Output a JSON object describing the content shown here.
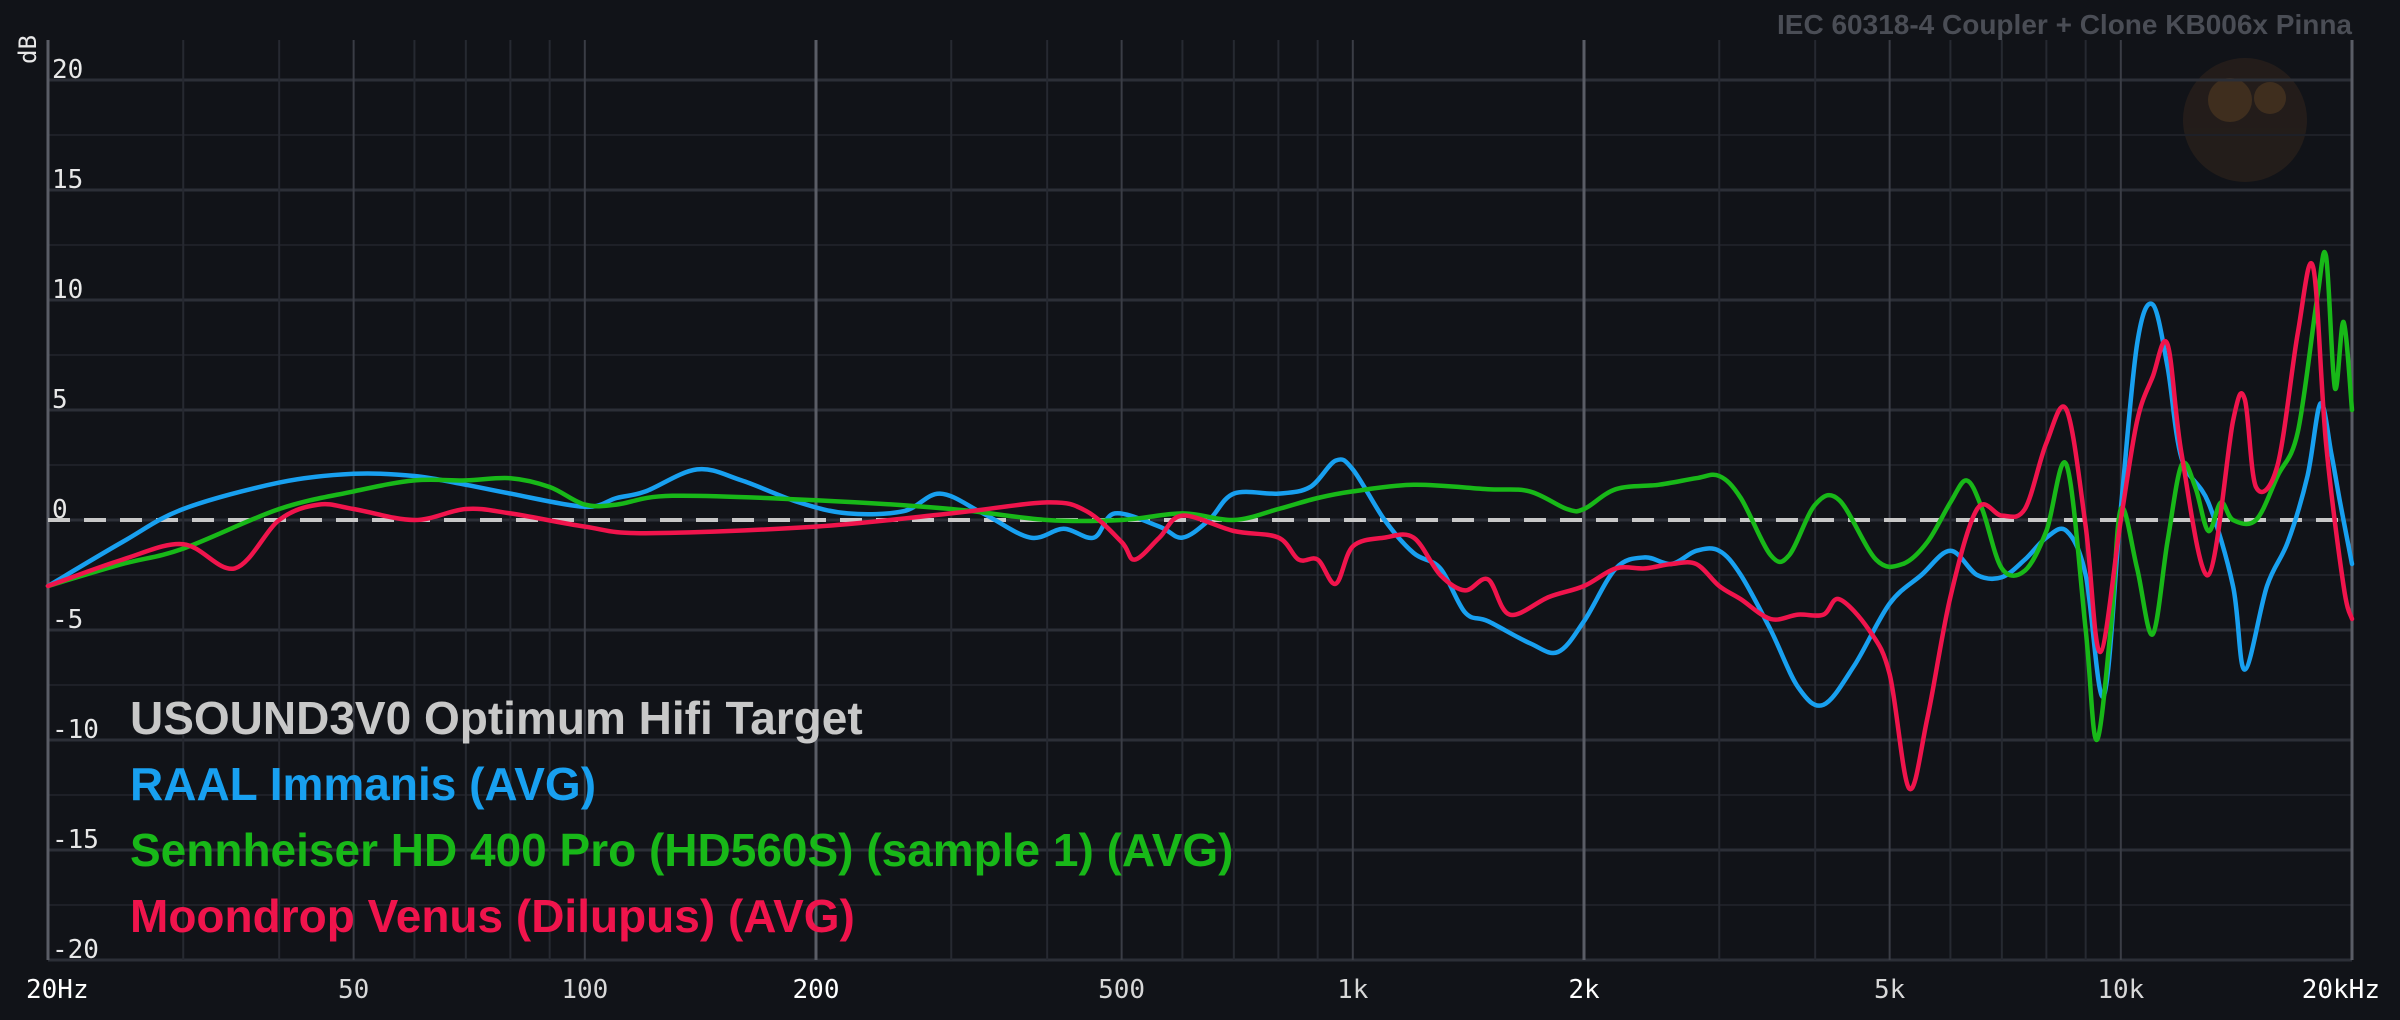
{
  "chart_data": {
    "type": "line",
    "title": "IEC 60318-4 Coupler + Clone KB006x Pinna",
    "ylabel": "dB",
    "xscale": "log",
    "xlim": [
      20,
      20000
    ],
    "ylim": [
      -20,
      21
    ],
    "y_ticks": [
      {
        "value": 20,
        "label": "20"
      },
      {
        "value": 15,
        "label": "15"
      },
      {
        "value": 10,
        "label": "10"
      },
      {
        "value": 5,
        "label": "5"
      },
      {
        "value": 0,
        "label": "0"
      },
      {
        "value": -5,
        "label": "-5"
      },
      {
        "value": -10,
        "label": "-10"
      },
      {
        "value": -15,
        "label": "-15"
      },
      {
        "value": -20,
        "label": "-20"
      }
    ],
    "x_ticks": [
      {
        "value": 20,
        "label": "20Hz",
        "major": true
      },
      {
        "value": 50,
        "label": "50",
        "major": false
      },
      {
        "value": 100,
        "label": "100",
        "major": false
      },
      {
        "value": 200,
        "label": "200",
        "major": true
      },
      {
        "value": 500,
        "label": "500",
        "major": false
      },
      {
        "value": 1000,
        "label": "1k",
        "major": false
      },
      {
        "value": 2000,
        "label": "2k",
        "major": true
      },
      {
        "value": 5000,
        "label": "5k",
        "major": false
      },
      {
        "value": 10000,
        "label": "10k",
        "major": false
      },
      {
        "value": 20000,
        "label": "20kHz",
        "major": true
      }
    ],
    "grid": true,
    "legend_position": "bottom-left",
    "series": [
      {
        "name": "USOUND3V0 Optimum Hifi Target",
        "color": "#c8c8c8",
        "style": "dashed",
        "points": [
          [
            20,
            0
          ],
          [
            20000,
            0
          ]
        ]
      },
      {
        "name": "RAAL Immanis (AVG)",
        "color": "#18a0f0",
        "points": [
          [
            20,
            -3
          ],
          [
            25,
            -1
          ],
          [
            30,
            0.5
          ],
          [
            40,
            1.7
          ],
          [
            50,
            2.1
          ],
          [
            60,
            2.0
          ],
          [
            70,
            1.6
          ],
          [
            80,
            1.2
          ],
          [
            100,
            0.6
          ],
          [
            110,
            1.0
          ],
          [
            120,
            1.3
          ],
          [
            140,
            2.3
          ],
          [
            160,
            1.8
          ],
          [
            190,
            0.8
          ],
          [
            220,
            0.3
          ],
          [
            260,
            0.4
          ],
          [
            290,
            1.2
          ],
          [
            330,
            0.3
          ],
          [
            380,
            -0.8
          ],
          [
            420,
            -0.4
          ],
          [
            460,
            -0.8
          ],
          [
            490,
            0.3
          ],
          [
            560,
            -0.3
          ],
          [
            600,
            -0.8
          ],
          [
            650,
            0
          ],
          [
            700,
            1.2
          ],
          [
            800,
            1.2
          ],
          [
            880,
            1.5
          ],
          [
            950,
            2.7
          ],
          [
            1000,
            2.3
          ],
          [
            1100,
            0
          ],
          [
            1200,
            -1.5
          ],
          [
            1300,
            -2.2
          ],
          [
            1400,
            -4.2
          ],
          [
            1500,
            -4.6
          ],
          [
            1700,
            -5.6
          ],
          [
            1850,
            -6.0
          ],
          [
            2000,
            -4.6
          ],
          [
            2200,
            -2.2
          ],
          [
            2400,
            -1.7
          ],
          [
            2600,
            -2.0
          ],
          [
            2800,
            -1.4
          ],
          [
            3000,
            -1.4
          ],
          [
            3200,
            -2.5
          ],
          [
            3500,
            -5.0
          ],
          [
            3800,
            -7.6
          ],
          [
            4100,
            -8.4
          ],
          [
            4500,
            -6.6
          ],
          [
            5000,
            -3.8
          ],
          [
            5500,
            -2.5
          ],
          [
            6000,
            -1.4
          ],
          [
            6500,
            -2.5
          ],
          [
            7000,
            -2.6
          ],
          [
            7500,
            -1.8
          ],
          [
            8000,
            -0.8
          ],
          [
            8500,
            -0.5
          ],
          [
            9000,
            -2.5
          ],
          [
            9500,
            -8.0
          ],
          [
            10000,
            0.5
          ],
          [
            10500,
            8.0
          ],
          [
            11000,
            9.8
          ],
          [
            11500,
            7.0
          ],
          [
            12000,
            2.8
          ],
          [
            13000,
            0.8
          ],
          [
            14000,
            -3.0
          ],
          [
            14500,
            -6.8
          ],
          [
            15500,
            -3.0
          ],
          [
            16500,
            -1.0
          ],
          [
            17500,
            2.0
          ],
          [
            18200,
            5.3
          ],
          [
            18800,
            3.0
          ],
          [
            19300,
            0.8
          ],
          [
            20000,
            -2.0
          ]
        ]
      },
      {
        "name": "Sennheiser HD 400 Pro (HD560S) (sample 1) (AVG)",
        "color": "#18b818",
        "points": [
          [
            20,
            -3
          ],
          [
            25,
            -2
          ],
          [
            30,
            -1.3
          ],
          [
            40,
            0.5
          ],
          [
            50,
            1.3
          ],
          [
            60,
            1.8
          ],
          [
            70,
            1.8
          ],
          [
            80,
            1.9
          ],
          [
            90,
            1.5
          ],
          [
            100,
            0.7
          ],
          [
            110,
            0.7
          ],
          [
            130,
            1.1
          ],
          [
            200,
            0.9
          ],
          [
            300,
            0.5
          ],
          [
            400,
            0
          ],
          [
            500,
            0
          ],
          [
            600,
            0.3
          ],
          [
            700,
            0
          ],
          [
            800,
            0.5
          ],
          [
            900,
            1.0
          ],
          [
            1000,
            1.3
          ],
          [
            1200,
            1.6
          ],
          [
            1500,
            1.4
          ],
          [
            1700,
            1.3
          ],
          [
            1900,
            0.5
          ],
          [
            2000,
            0.5
          ],
          [
            2200,
            1.4
          ],
          [
            2500,
            1.6
          ],
          [
            2800,
            1.9
          ],
          [
            3000,
            2.0
          ],
          [
            3200,
            1.0
          ],
          [
            3500,
            -1.6
          ],
          [
            3700,
            -1.6
          ],
          [
            4000,
            0.7
          ],
          [
            4300,
            0.9
          ],
          [
            4800,
            -1.8
          ],
          [
            5200,
            -2.0
          ],
          [
            5600,
            -1.0
          ],
          [
            6000,
            0.8
          ],
          [
            6300,
            1.8
          ],
          [
            6600,
            0.5
          ],
          [
            7000,
            -2.2
          ],
          [
            7500,
            -2.3
          ],
          [
            8000,
            -0.5
          ],
          [
            8500,
            2.5
          ],
          [
            9000,
            -5.0
          ],
          [
            9300,
            -10.0
          ],
          [
            9700,
            -5.0
          ],
          [
            10000,
            0.5
          ],
          [
            10500,
            -2.2
          ],
          [
            11000,
            -5.2
          ],
          [
            11500,
            -1.0
          ],
          [
            12000,
            2.5
          ],
          [
            12500,
            1.5
          ],
          [
            13000,
            -0.5
          ],
          [
            13500,
            0.8
          ],
          [
            14000,
            0
          ],
          [
            15000,
            0
          ],
          [
            16000,
            2.0
          ],
          [
            17000,
            4.0
          ],
          [
            18000,
            10.0
          ],
          [
            18500,
            12.0
          ],
          [
            19000,
            6.0
          ],
          [
            19500,
            9.0
          ],
          [
            20000,
            5.0
          ]
        ]
      },
      {
        "name": "Moondrop Venus (Dilupus) (AVG)",
        "color": "#f0144c",
        "points": [
          [
            20,
            -3
          ],
          [
            25,
            -1.8
          ],
          [
            30,
            -1.1
          ],
          [
            35,
            -2.2
          ],
          [
            40,
            0
          ],
          [
            45,
            0.7
          ],
          [
            50,
            0.5
          ],
          [
            60,
            0
          ],
          [
            70,
            0.5
          ],
          [
            80,
            0.3
          ],
          [
            100,
            -0.3
          ],
          [
            120,
            -0.6
          ],
          [
            200,
            -0.3
          ],
          [
            300,
            0.3
          ],
          [
            400,
            0.8
          ],
          [
            450,
            0.4
          ],
          [
            500,
            -1.0
          ],
          [
            520,
            -1.8
          ],
          [
            560,
            -0.8
          ],
          [
            600,
            0.2
          ],
          [
            700,
            -0.5
          ],
          [
            800,
            -0.8
          ],
          [
            850,
            -1.8
          ],
          [
            900,
            -1.8
          ],
          [
            950,
            -2.9
          ],
          [
            1000,
            -1.2
          ],
          [
            1100,
            -0.8
          ],
          [
            1200,
            -0.8
          ],
          [
            1300,
            -2.5
          ],
          [
            1400,
            -3.2
          ],
          [
            1500,
            -2.7
          ],
          [
            1600,
            -4.3
          ],
          [
            1800,
            -3.5
          ],
          [
            2000,
            -3.0
          ],
          [
            2200,
            -2.2
          ],
          [
            2400,
            -2.2
          ],
          [
            2600,
            -2.0
          ],
          [
            2800,
            -2.0
          ],
          [
            3000,
            -3.0
          ],
          [
            3200,
            -3.6
          ],
          [
            3500,
            -4.5
          ],
          [
            3800,
            -4.3
          ],
          [
            4100,
            -4.3
          ],
          [
            4300,
            -3.6
          ],
          [
            4700,
            -5.0
          ],
          [
            5000,
            -7.0
          ],
          [
            5300,
            -12.2
          ],
          [
            5600,
            -9.0
          ],
          [
            6000,
            -3.5
          ],
          [
            6500,
            0.5
          ],
          [
            7000,
            0.2
          ],
          [
            7500,
            0.5
          ],
          [
            8000,
            3.5
          ],
          [
            8500,
            5.0
          ],
          [
            9000,
            -0.3
          ],
          [
            9400,
            -6.0
          ],
          [
            10000,
            0
          ],
          [
            10500,
            4.5
          ],
          [
            11000,
            6.5
          ],
          [
            11500,
            8.0
          ],
          [
            12000,
            3.0
          ],
          [
            13000,
            -2.5
          ],
          [
            14000,
            4.5
          ],
          [
            14500,
            5.5
          ],
          [
            15000,
            1.5
          ],
          [
            16000,
            2.5
          ],
          [
            17000,
            8.5
          ],
          [
            17800,
            11.5
          ],
          [
            18500,
            3.5
          ],
          [
            19500,
            -3.0
          ],
          [
            20000,
            -4.5
          ]
        ]
      }
    ]
  }
}
